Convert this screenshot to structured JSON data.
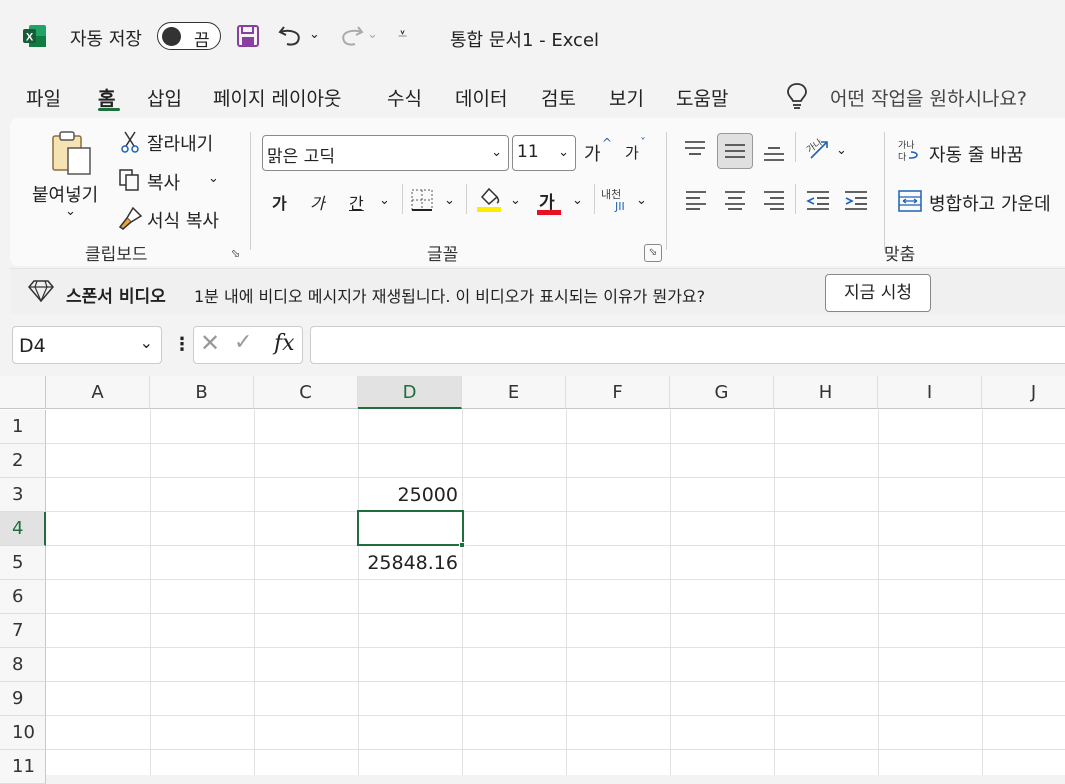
{
  "titlebar": {
    "autosave_label": "자동 저장",
    "autosave_state": "끔",
    "doc_title": "통합 문서1  -  Excel"
  },
  "menu": {
    "items": [
      "파일",
      "홈",
      "삽입",
      "페이지 레이아웃",
      "수식",
      "데이터",
      "검토",
      "보기",
      "도움말"
    ],
    "active": "홈",
    "search_placeholder": "어떤 작업을 원하시나요?"
  },
  "ribbon": {
    "clipboard": {
      "paste": "붙여넣기",
      "cut": "잘라내기",
      "copy": "복사",
      "format_painter": "서식 복사",
      "group_label": "클립보드"
    },
    "font": {
      "font_name": "맑은 고딕",
      "font_size": "11",
      "bold": "가",
      "italic": "가",
      "underline": "간",
      "font_color_glyph": "가",
      "grow": "가",
      "shrink": "가",
      "phonetic": "내천",
      "group_label": "글꼴"
    },
    "alignment": {
      "wrap_text": "자동 줄 바꿈",
      "merge_center": "병합하고 가운데",
      "group_label": "맞춤"
    }
  },
  "banner": {
    "title": "스폰서 비디오",
    "message": "1분 내에 비디오 메시지가 재생됩니다. 이 비디오가 표시되는 이유가 뭔가요?",
    "button": "지금 시청"
  },
  "formula_bar": {
    "name_box": "D4",
    "fx": "fx",
    "formula": ""
  },
  "sheet": {
    "columns": [
      "A",
      "B",
      "C",
      "D",
      "E",
      "F",
      "G",
      "H",
      "I",
      "J"
    ],
    "rows": [
      "1",
      "2",
      "3",
      "4",
      "5",
      "6",
      "7",
      "8",
      "9",
      "10",
      "11"
    ],
    "selected_cell": "D4",
    "cells": {
      "D3": "25000",
      "D5": "25848.16"
    }
  },
  "colors": {
    "accent": "#1e6e3e",
    "excel_green": "#107c41",
    "save_purple": "#8a3fa0",
    "highlight_yellow": "#ffeb00",
    "font_red": "#e81123"
  }
}
